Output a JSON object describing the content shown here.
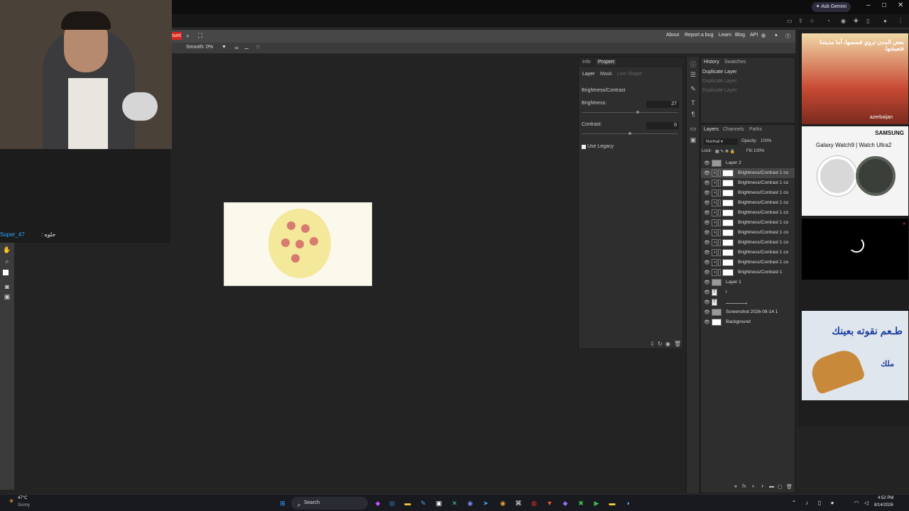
{
  "titlebar": {
    "ask_label": "Ask Gemini",
    "minimize": "–",
    "maximize": "□",
    "close": "✕"
  },
  "menubar": {
    "red_label": "ount",
    "links": [
      "About",
      "Report a bug",
      "Learn",
      "Blog",
      "API"
    ]
  },
  "optbar": {
    "smooth_label": "Smooth:",
    "smooth_value": "0%"
  },
  "chat": {
    "user": "Super_47",
    "text": ": حلوه"
  },
  "properties": {
    "tabs": [
      "Info",
      "Propert"
    ],
    "subtabs": [
      "Layer",
      "Mask",
      "Live Shape"
    ],
    "title": "Brightness/Contrast",
    "brightness_label": "Brightness:",
    "brightness_value": "27",
    "contrast_label": "Contrast:",
    "contrast_value": "0",
    "legacy_label": "Use Legacy"
  },
  "history": {
    "tabs": [
      "History",
      "Swatches"
    ],
    "items": [
      "Duplicate Layer",
      "Duplicate Layer",
      "Duplicate Layer"
    ]
  },
  "layers": {
    "tabs": [
      "Layers",
      "Channels",
      "Paths"
    ],
    "blend": "Normal",
    "opacity_label": "Opacity:",
    "opacity_value": "100%",
    "lock_label": "Lock:",
    "fill_label": "Fill:",
    "fill_value": "100%",
    "items": [
      "Layer 2",
      "Brightness/Contrast 1 co",
      "Brightness/Contrast 1 co",
      "Brightness/Contrast 1 co",
      "Brightness/Contrast 1 co",
      "Brightness/Contrast 1 co",
      "Brightness/Contrast 1 co",
      "Brightness/Contrast 1 co",
      "Brightness/Contrast 1 co",
      "Brightness/Contrast 1 co",
      "Brightness/Contrast 1 co",
      "Brightness/Contrast 1",
      "Layer 1",
      "l",
      "بـــــــــــــــ",
      "Screenshot 2026-08-14 1",
      "Background"
    ]
  },
  "ads": {
    "ad1_text": "بعض المدن تروي قصصها، أما مدينتنا فتعيشها.",
    "ad1_brand": "azerbaijan",
    "ad2_brand": "SAMSUNG",
    "ad2_text": "Galaxy Watch9 | Watch Ultra2",
    "ad4_text": "طـعم نقوته بعينك",
    "ad4_sub": "ملك"
  },
  "taskbar": {
    "weather_temp": "47°C",
    "weather_desc": "Sunny",
    "search_label": "Search",
    "time": "4:52 PM",
    "date": "8/14/2026"
  }
}
